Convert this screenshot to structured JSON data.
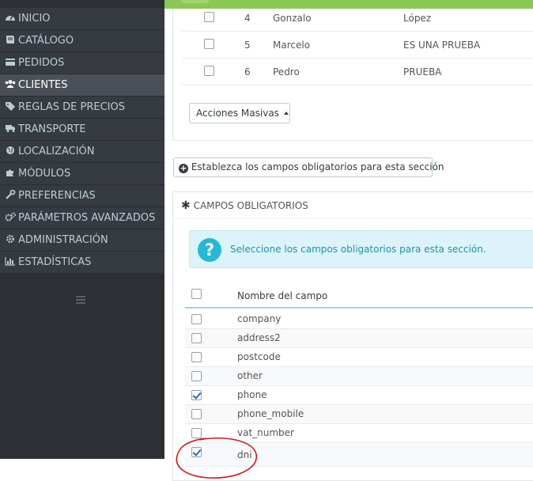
{
  "sidebar": {
    "items": [
      {
        "label": "INICIO",
        "icon": "tachometer-icon"
      },
      {
        "label": "CATÁLOGO",
        "icon": "book-icon"
      },
      {
        "label": "PEDIDOS",
        "icon": "credit-card-icon"
      },
      {
        "label": "CLIENTES",
        "icon": "users-icon",
        "active": true
      },
      {
        "label": "REGLAS DE PRECIOS",
        "icon": "tags-icon"
      },
      {
        "label": "TRANSPORTE",
        "icon": "truck-icon"
      },
      {
        "label": "LOCALIZACIÓN",
        "icon": "globe-icon"
      },
      {
        "label": "MÓDULOS",
        "icon": "puzzle-icon"
      },
      {
        "label": "PREFERENCIAS",
        "icon": "wrench-icon"
      },
      {
        "label": "PARÁMETROS AVANZADOS",
        "icon": "cogs-icon"
      },
      {
        "label": "ADMINISTRACIÓN",
        "icon": "cog-icon"
      },
      {
        "label": "ESTADÍSTICAS",
        "icon": "bar-chart-icon"
      }
    ],
    "toggle_icon": "bars-icon"
  },
  "list": {
    "rows": [
      {
        "id": "4",
        "firstname": "Gonzalo",
        "lastname": "López",
        "checked": false
      },
      {
        "id": "5",
        "firstname": "Marcelo",
        "lastname": "ES UNA PRUEBA",
        "checked": false
      },
      {
        "id": "6",
        "firstname": "Pedro",
        "lastname": "PRUEBA",
        "checked": false
      }
    ],
    "bulk_actions_label": "Acciones Masivas"
  },
  "required_fields_button": {
    "label": "Establezca los campos obligatorios para esta sección",
    "icon": "plus-circle-icon"
  },
  "required_panel": {
    "heading": "CAMPOS OBLIGATORIOS",
    "heading_icon": "asterisk-icon",
    "alert_text": "Seleccione los campos obligatorios para esta sección.",
    "alert_icon": "question-icon",
    "column_header": "Nombre del campo",
    "fields": [
      {
        "name": "company",
        "checked": false
      },
      {
        "name": "address2",
        "checked": false
      },
      {
        "name": "postcode",
        "checked": false
      },
      {
        "name": "other",
        "checked": false
      },
      {
        "name": "phone",
        "checked": true
      },
      {
        "name": "phone_mobile",
        "checked": false
      },
      {
        "name": "vat_number",
        "checked": false
      },
      {
        "name": "dni",
        "checked": true
      }
    ]
  },
  "colors": {
    "sidebar_bg": "#363a41",
    "sidebar_active": "#4b5058",
    "accent_green": "#8bc954",
    "info_blue": "#25b9d7",
    "annotation_red": "#d8161b"
  }
}
